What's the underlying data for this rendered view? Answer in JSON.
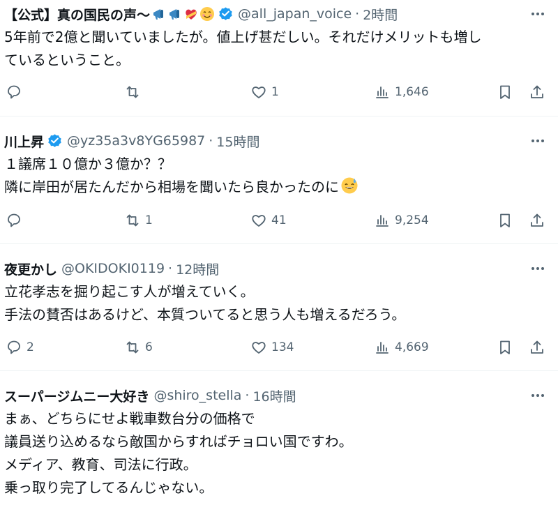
{
  "icons": {
    "more": "more-horizontal-icon",
    "reply": "reply-icon",
    "retweet": "retweet-icon",
    "like": "heart-icon",
    "views": "views-bar-icon",
    "bookmark": "bookmark-icon",
    "share": "share-icon",
    "verified": "verified-badge-icon"
  },
  "colors": {
    "verified": "#1d9bf0",
    "muted": "#536471",
    "text": "#0f1419",
    "divider": "#eff3f4"
  },
  "tweets": [
    {
      "name": "【公式】真の国民の声〜",
      "name_emojis": [
        "megaphone-icon",
        "megaphone-icon",
        "heart-with-ribbon-icon",
        "smiling-face-icon"
      ],
      "handle": "@all_japan_voice",
      "time": "2時間",
      "lines": [
        "5年前で2億と聞いていましたが。値上げ甚だしい。それだけメリットも増し",
        "ているということ。"
      ],
      "replies": "",
      "retweets": "",
      "likes": "1",
      "views": "1,646"
    },
    {
      "name": "川上昇",
      "handle": "@yz35a3v8YG65987",
      "time": "15時間",
      "lines": [
        "１議席１０億か３億か？？",
        "隣に岸田が居たんだから相場を聞いたら良かったのに"
      ],
      "line_end_emoji": "grinning-face-with-sweat-icon",
      "replies": "",
      "retweets": "1",
      "likes": "41",
      "views": "9,254"
    },
    {
      "name": "夜更かし",
      "handle": "@OKIDOKI0119",
      "time": "12時間",
      "lines": [
        "立花孝志を掘り起こす人が増えていく。",
        "手法の賛否はあるけど、本質ついてると思う人も増えるだろう。"
      ],
      "replies": "2",
      "retweets": "6",
      "likes": "134",
      "views": "4,669"
    },
    {
      "name": "スーパージムニー大好き",
      "handle": "@shiro_stella",
      "time": "16時間",
      "lines": [
        "まぁ、どちらにせよ戦車数台分の価格で",
        "議員送り込めるなら敵国からすればチョロい国ですわ。",
        "メディア、教育、司法に行政。",
        "乗っ取り完了してるんじゃない。"
      ]
    }
  ]
}
